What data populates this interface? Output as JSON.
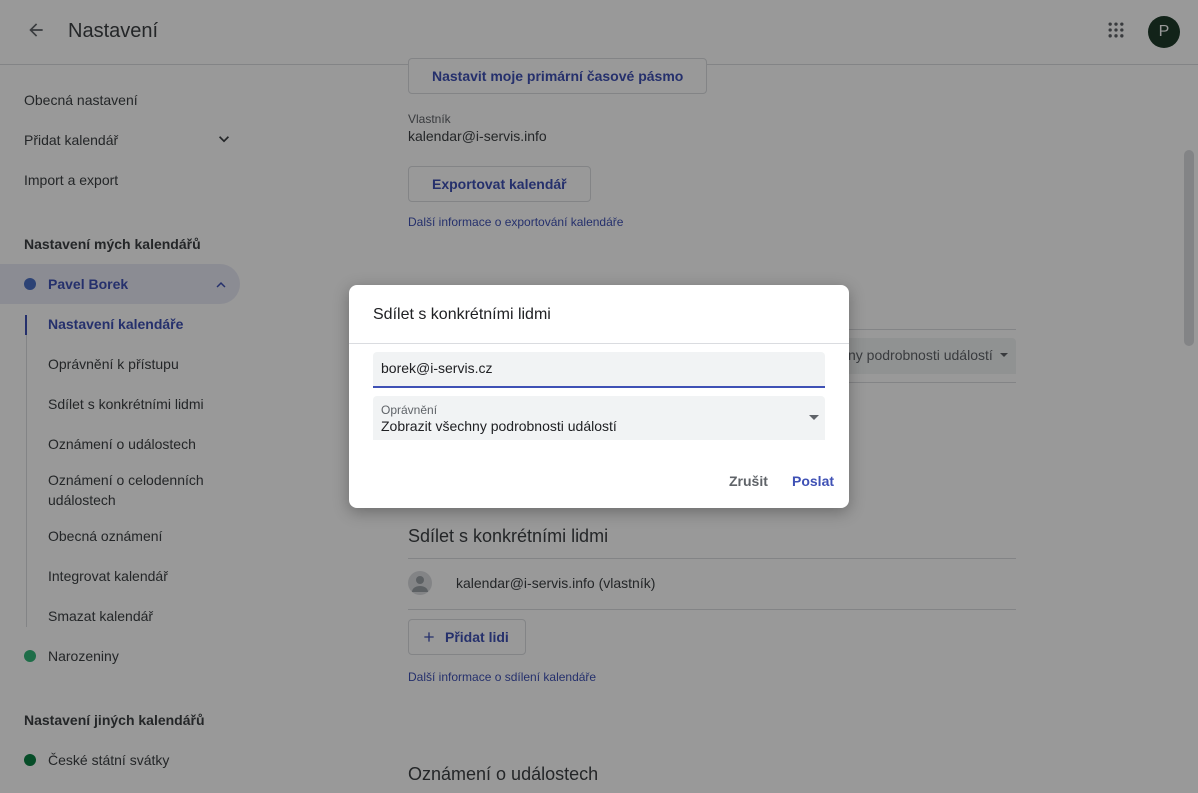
{
  "header": {
    "title": "Nastavení",
    "avatar_letter": "P"
  },
  "sidebar": {
    "items": [
      {
        "label": "Obecná nastavení"
      },
      {
        "label": "Přidat kalendář"
      },
      {
        "label": "Import a export"
      }
    ],
    "my_calendars_title": "Nastavení mých kalendářů",
    "active_calendar": {
      "label": "Pavel Borek",
      "color": "#4a6fc4"
    },
    "sub_items": [
      {
        "label": "Nastavení kalendáře"
      },
      {
        "label": "Oprávnění k přístupu"
      },
      {
        "label": "Sdílet s konkrétními lidmi"
      },
      {
        "label": "Oznámení o událostech"
      },
      {
        "label": "Oznámení o celodenních"
      },
      {
        "label": "událostech"
      },
      {
        "label": "Obecná oznámení"
      },
      {
        "label": "Integrovat kalendář"
      },
      {
        "label": "Smazat kalendář"
      }
    ],
    "birthdays": {
      "label": "Narozeniny",
      "color": "#33b679"
    },
    "other_calendars_title": "Nastavení jiných kalendářů",
    "holidays": {
      "label": "České státní svátky",
      "color": "#0b8043"
    }
  },
  "main": {
    "set_timezone_button": "Nastavit moje primární časové pásmo",
    "owner_label": "Vlastník",
    "owner_value": "kalendar@i-servis.info",
    "export_button": "Exportovat kalendář",
    "export_info_link": "Další informace o exportování kalendáře",
    "bg_select_value": "ny podrobnosti událostí",
    "share_heading": "Sdílet s konkrétními lidmi",
    "share_owner_row": "kalendar@i-servis.info (vlastník)",
    "add_people_button": "Přidat lidi",
    "share_info_link": "Další informace o sdílení kalendáře",
    "notifications_heading": "Oznámení o událostech"
  },
  "dialog": {
    "title": "Sdílet s konkrétními lidmi",
    "email_value": "borek@i-servis.cz",
    "permission_label": "Oprávnění",
    "permission_value": "Zobrazit všechny podrobnosti událostí",
    "cancel_label": "Zrušit",
    "send_label": "Poslat"
  },
  "colors": {
    "accent": "#3f51b5"
  }
}
